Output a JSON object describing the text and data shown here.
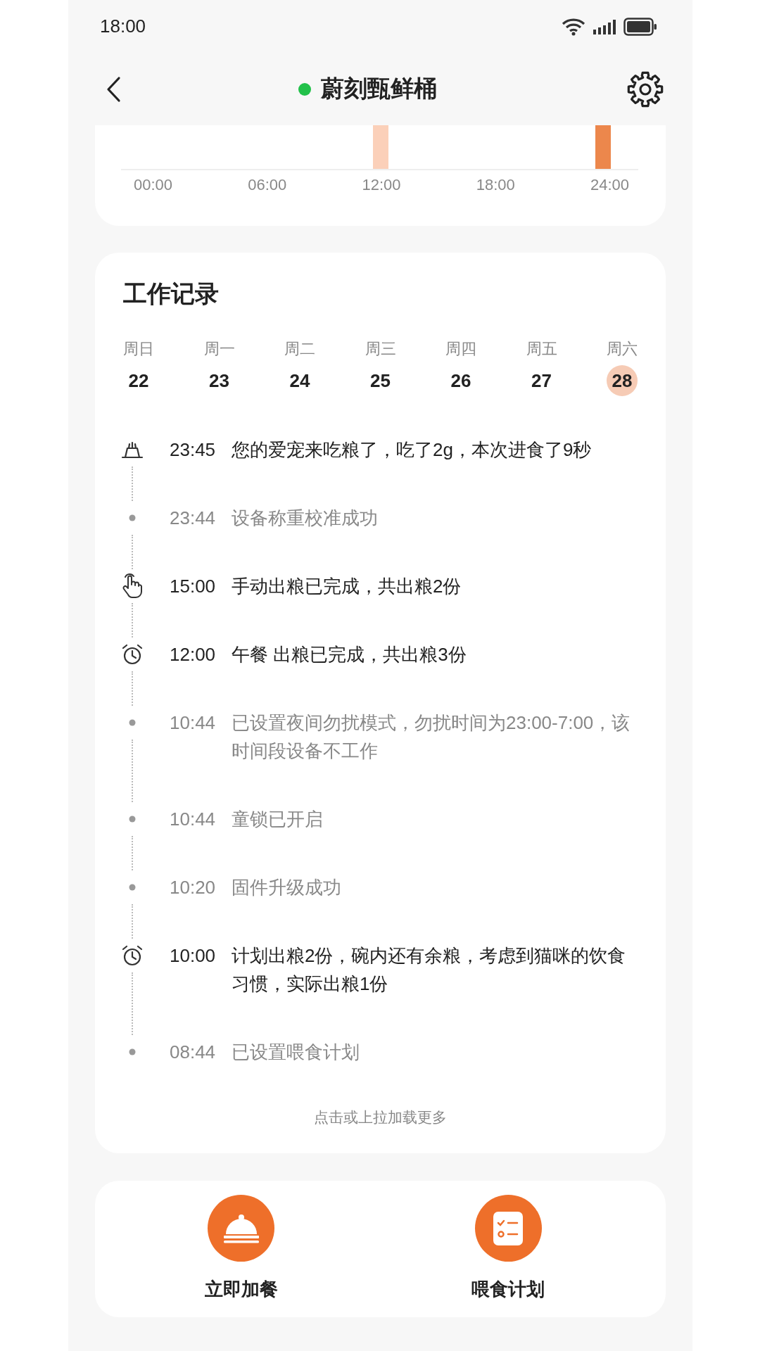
{
  "status_bar": {
    "time": "18:00"
  },
  "header": {
    "title": "蔚刻甄鲜桶",
    "online": true
  },
  "chart": {
    "axis_labels": [
      "00:00",
      "06:00",
      "12:00",
      "18:00",
      "24:00"
    ]
  },
  "work_log": {
    "title": "工作记录",
    "days": [
      {
        "weekday": "周日",
        "date": "22",
        "selected": false
      },
      {
        "weekday": "周一",
        "date": "23",
        "selected": false
      },
      {
        "weekday": "周二",
        "date": "24",
        "selected": false
      },
      {
        "weekday": "周三",
        "date": "25",
        "selected": false
      },
      {
        "weekday": "周四",
        "date": "26",
        "selected": false
      },
      {
        "weekday": "周五",
        "date": "27",
        "selected": false
      },
      {
        "weekday": "周六",
        "date": "28",
        "selected": true
      }
    ],
    "entries": [
      {
        "kind": "feed",
        "time": "23:45",
        "text": "您的爱宠来吃粮了，吃了2g，本次进食了9秒"
      },
      {
        "kind": "system",
        "time": "23:44",
        "text": "设备称重校准成功"
      },
      {
        "kind": "manual",
        "time": "15:00",
        "text": "手动出粮已完成，共出粮2份"
      },
      {
        "kind": "schedule",
        "time": "12:00",
        "text": "午餐 出粮已完成，共出粮3份"
      },
      {
        "kind": "system",
        "time": "10:44",
        "text": "已设置夜间勿扰模式，勿扰时间为23:00-7:00，该时间段设备不工作"
      },
      {
        "kind": "system",
        "time": "10:44",
        "text": "童锁已开启"
      },
      {
        "kind": "system",
        "time": "10:20",
        "text": "固件升级成功"
      },
      {
        "kind": "schedule",
        "time": "10:00",
        "text": "计划出粮2份，碗内还有余粮，考虑到猫咪的饮食习惯，实际出粮1份"
      },
      {
        "kind": "system",
        "time": "08:44",
        "text": "已设置喂食计划"
      }
    ],
    "load_more": "点击或上拉加载更多"
  },
  "actions": [
    {
      "kind": "add_meal",
      "label": "立即加餐"
    },
    {
      "kind": "feeding_plan",
      "label": "喂食计划"
    }
  ]
}
